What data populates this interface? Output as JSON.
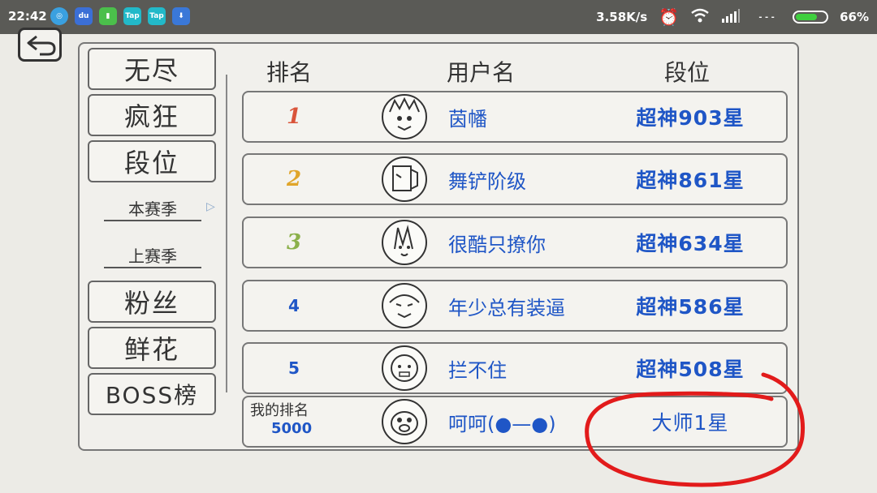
{
  "status_bar": {
    "time": "22:42",
    "network_speed": "3.58K/s",
    "battery_percent": "66%",
    "battery_level": 0.66,
    "app_icons": [
      {
        "name": "browser-icon",
        "color": "#3aa0e0",
        "text": ""
      },
      {
        "name": "du-icon",
        "color": "#3b6fd6",
        "text": "du"
      },
      {
        "name": "clipboard-icon",
        "color": "#4bbf4b",
        "text": ""
      },
      {
        "name": "taptap-icon",
        "color": "#22b9c9",
        "text": "Tap"
      },
      {
        "name": "taptap-icon-2",
        "color": "#22b9c9",
        "text": "Tap"
      },
      {
        "name": "download-icon",
        "color": "#3a78d8",
        "text": ""
      }
    ]
  },
  "sidebar": {
    "endless": "无尽",
    "crazy": "疯狂",
    "rank": "段位",
    "this_season": "本赛季",
    "last_season": "上赛季",
    "fans": "粉丝",
    "flowers": "鲜花",
    "boss": "BOSS榜"
  },
  "headers": {
    "rank": "排名",
    "username": "用户名",
    "tier": "段位"
  },
  "rows": [
    {
      "rank": "1",
      "name": "茵幡",
      "tier": "超神903星"
    },
    {
      "rank": "2",
      "name": "舞铲阶级",
      "tier": "超神861星"
    },
    {
      "rank": "3",
      "name": "很酷只撩你",
      "tier": "超神634星"
    },
    {
      "rank": "4",
      "name": "年少总有装逼",
      "tier": "超神586星"
    },
    {
      "rank": "5",
      "name": "拦不住",
      "tier": "超神508星"
    }
  ],
  "my_row": {
    "label": "我的排名",
    "rank": "5000",
    "name": "呵呵(●—●)",
    "tier": "大师1星"
  },
  "colors": {
    "accent_blue": "#1f56c6",
    "rank1": "#d9543a",
    "rank2": "#e0a52a",
    "rank3": "#8bb04a",
    "annotation_red": "#e21b1b"
  }
}
